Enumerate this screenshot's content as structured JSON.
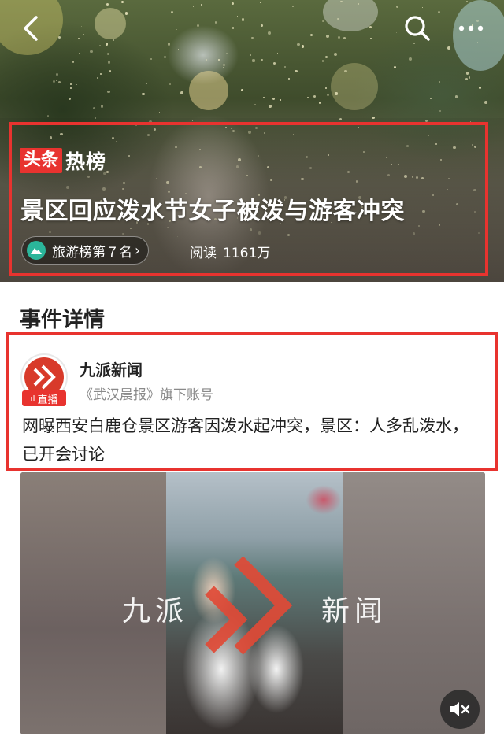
{
  "topbar": {
    "back_icon": "back-arrow-icon",
    "search_icon": "search-icon",
    "more_icon": "more-dots-icon"
  },
  "hero": {
    "brand_badge": "头条",
    "hotlist_label": "热榜",
    "headline": "景区回应泼水节女子被泼与游客冲突",
    "rank_label": "旅游榜第７名",
    "read_label": "阅读",
    "read_count": "1161万"
  },
  "event": {
    "section_title": "事件详情",
    "source": {
      "name": "九派新闻",
      "live_badge": "直播",
      "sub": "《武汉晨报》旗下账号"
    },
    "body": "网曝西安白鹿仓景区游客因泼水起冲突，景区：人多乱泼水，已开会讨论"
  },
  "video": {
    "watermark_left": "九派",
    "watermark_right": "新闻",
    "mute_icon": "mute-speaker-icon"
  },
  "colors": {
    "accent_red": "#e8332f",
    "rank_green": "#2bb59a"
  }
}
